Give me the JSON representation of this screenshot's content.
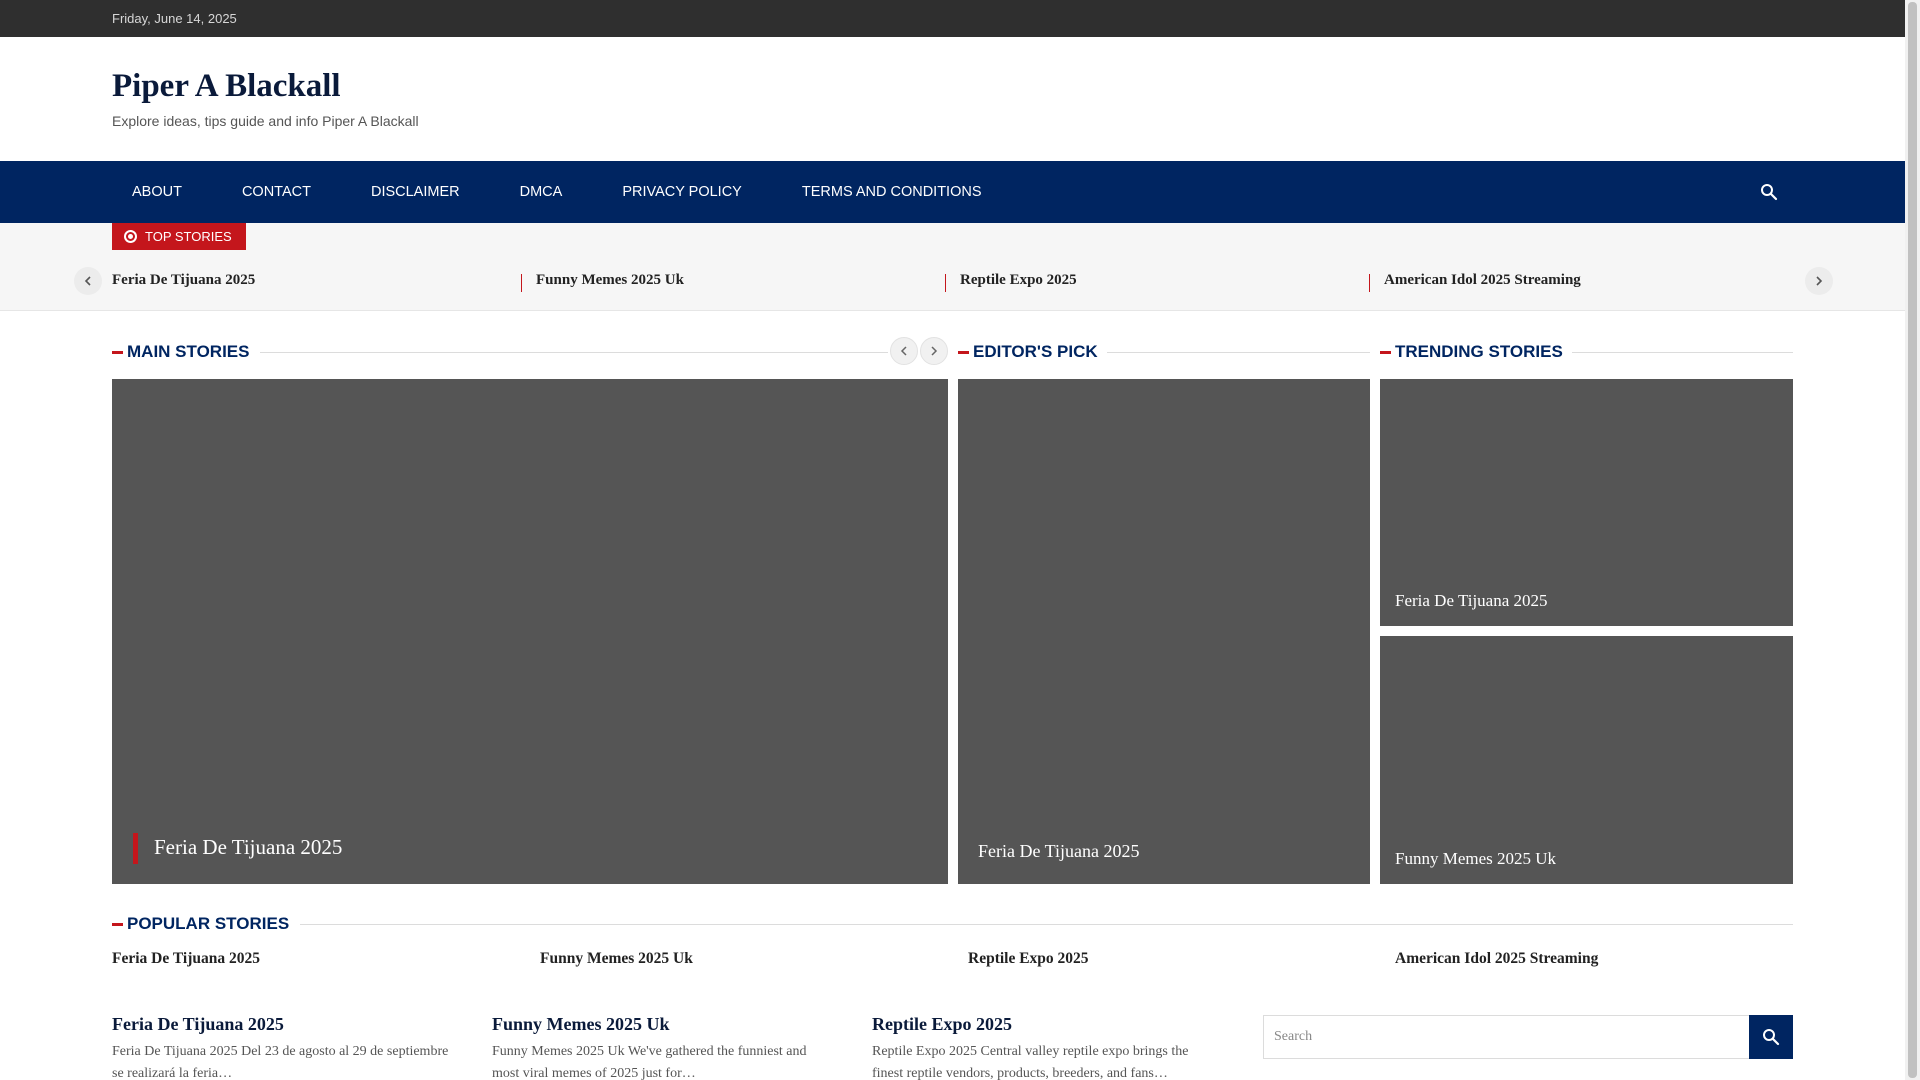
{
  "topbar": {
    "date": "Friday, June 14, 2025"
  },
  "site": {
    "title": "Piper A Blackall",
    "tagline": "Explore ideas, tips guide and info Piper A Blackall"
  },
  "nav": {
    "items": [
      "ABOUT",
      "CONTACT",
      "DISCLAIMER",
      "DMCA",
      "PRIVACY POLICY",
      "TERMS AND CONDITIONS"
    ],
    "search_icon": "search-icon"
  },
  "ticker": {
    "label": "TOP STORIES",
    "items": [
      "Feria De Tijuana 2025",
      "Funny Memes 2025 Uk",
      "Reptile Expo 2025",
      "American Idol 2025 Streaming"
    ]
  },
  "sections": {
    "main": "MAIN STORIES",
    "editors": "EDITOR'S PICK",
    "trending": "TRENDING STORIES",
    "popular": "POPULAR STORIES"
  },
  "main_story": {
    "title": "Feria De Tijuana 2025"
  },
  "editors_pick": {
    "title": "Feria De Tijuana 2025"
  },
  "trending": [
    {
      "title": "Feria De Tijuana 2025"
    },
    {
      "title": "Funny Memes 2025 Uk"
    }
  ],
  "popular": [
    "Feria De Tijuana 2025",
    "Funny Memes 2025 Uk",
    "Reptile Expo 2025",
    "American Idol 2025 Streaming"
  ],
  "posts": [
    {
      "title": "Feria De Tijuana 2025",
      "excerpt": "Feria De Tijuana 2025 Del 23 de agosto al 29 de septiembre se realizará la feria…"
    },
    {
      "title": "Funny Memes 2025 Uk",
      "excerpt": "Funny Memes 2025 Uk We've gathered the funniest and most viral memes of 2025 just for…"
    },
    {
      "title": "Reptile Expo 2025",
      "excerpt": "Reptile Expo 2025 Central valley reptile expo brings the finest reptile vendors, products, breeders, and fans…"
    }
  ],
  "search": {
    "placeholder": "Search"
  },
  "colors": {
    "navy": "#002561",
    "red": "#c4161c",
    "card": "#555555",
    "topbar": "#2f2f2f"
  }
}
